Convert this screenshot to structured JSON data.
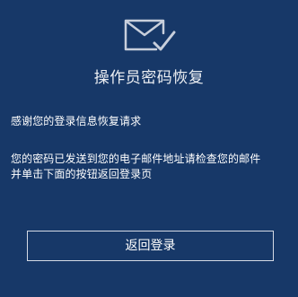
{
  "page": {
    "title": "操作员密码恢复",
    "icon": "mail-check-icon",
    "message_thanks": "感谢您的登录信息恢复请求",
    "message_detail_line1": "您的密码已发送到您的电子邮件地址请检查您的邮件",
    "message_detail_line2": "并单击下面的按钮返回登录页",
    "back_button_label": "返回登录"
  },
  "colors": {
    "background": "#173868",
    "text": "#ffffff",
    "button_border": "#d6dbe6",
    "icon_stroke": "#c8cfdc"
  }
}
